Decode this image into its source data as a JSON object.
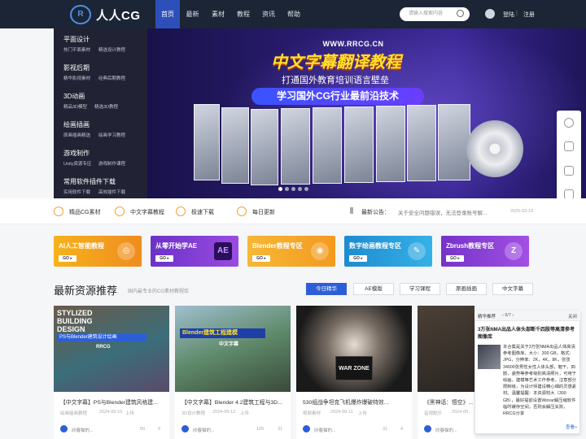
{
  "header": {
    "logo_text": "人人CG",
    "nav": [
      "首页",
      "最新",
      "素材",
      "教程",
      "资讯",
      "帮助"
    ],
    "search_placeholder": "请输入搜索内容",
    "login": "登陆",
    "divider": "|",
    "register": "注册"
  },
  "sidebar": [
    {
      "title": "平面设计",
      "subs": [
        "热门平面素材",
        "精选设计教程"
      ]
    },
    {
      "title": "影视后期",
      "subs": [
        "精华影视素材",
        "经典后期教程"
      ]
    },
    {
      "title": "3D动画",
      "subs": [
        "精品3D模型",
        "精选3D教程"
      ]
    },
    {
      "title": "绘画插画",
      "subs": [
        "原画插画精选",
        "绘画学习教程"
      ]
    },
    {
      "title": "游戏制作",
      "subs": [
        "Unity资源专区",
        "游戏制作课程"
      ]
    },
    {
      "title": "常用软件插件下载",
      "subs": [
        "实用软件下载",
        "高效插件下载"
      ]
    }
  ],
  "banner": {
    "site": "WWW.RRCG.CN",
    "title": "中文字幕翻译教程",
    "subtitle": "打通国外教育培训语言壁垒",
    "pill": "学习国外CG行业最前沿技术"
  },
  "quick_links": [
    "精品CG素材",
    "中文字幕教程",
    "极速下载",
    "每日更新"
  ],
  "notice": {
    "label": "最新公告：",
    "text": "关于安全问题错误，无法登录账号解...",
    "date": "2025-03-19"
  },
  "promo_cards": [
    {
      "title": "AI人工智能教程",
      "go": "GO ▸",
      "art": "◎",
      "color": "#f2a51d"
    },
    {
      "title": "从零开始学AE",
      "go": "GO ▸",
      "art": "AE",
      "color": "#8a3fd6"
    },
    {
      "title": "Blender教程专区",
      "go": "GO ▸",
      "art": "◉",
      "color": "#f5a623"
    },
    {
      "title": "数字绘画教程专区",
      "go": "GO ▸",
      "art": "✎",
      "color": "#2aa0d8"
    },
    {
      "title": "Zbrush教程专区",
      "go": "GO ▸",
      "art": "Z",
      "color": "#8b40d8"
    }
  ],
  "section": {
    "title": "最新资源推荐",
    "subtitle": "国内最专业的CG素材教程库",
    "tabs": [
      "今日精华",
      "AE模版",
      "学习课程",
      "原画插画",
      "中文字幕"
    ],
    "active_tab": 0
  },
  "resources": [
    {
      "title": "【中文字幕】PS与Blender建筑风格建...",
      "category": "绘画插画教程",
      "date": "2024-09-10",
      "action": "上传",
      "author": "欣春猫的...",
      "views": "50",
      "comments": "6"
    },
    {
      "title": "【中文字幕】Blender 4.2建筑工程与3D...",
      "category": "3D设计教程",
      "date": "2024-09-12",
      "action": "上传",
      "author": "欣春猫的...",
      "views": "105",
      "comments": "31"
    },
    {
      "title": "530组战争坦克飞机爆炸爆破特效...",
      "category": "视频素材",
      "date": "2024-09-11",
      "action": "上传",
      "author": "欣春猫的...",
      "views": "31",
      "comments": "4"
    },
    {
      "title": "《黑神话：悟空》...",
      "category": "音视配乐",
      "date": "2024-09",
      "action": "",
      "author": "欣春猫的...",
      "views": "",
      "comments": ""
    }
  ],
  "thumbs": {
    "t1": {
      "line1": "STYLIZED",
      "line2": "BUILDING",
      "line3": "DESIGN",
      "bar": "PS与Blender建筑设计绘画",
      "brand": "RRCG"
    },
    "t2": {
      "bar": "Blender建筑工程建模",
      "tag": "中文字幕"
    },
    "t3": {
      "big": "WAR ZONE"
    }
  },
  "popup": {
    "label": "精华推荐",
    "page": "‹ 5/7 ›",
    "close": "关闭",
    "title": "3万张NMA出品人体头部断千四肢等高清参考图像库",
    "body": "本合集是关于3万张NMA出品人体高清参考图像库，大小：300 GB，格式：JPG，分辨率：2K，4K，8K，张张34000张男性女性人体头部，躯干，四肢，姿势等参考级别高清照片，可用于绘画，建模等艺术工作参考，注意部分限制级，为设计师建设精心细的灵感素材。温馨提醒：本资源较大（300 GB），最好提前设置Winrar解压缩软件临时缓存空间，否则会解压失败，RRCG分享",
    "more": "查看»"
  },
  "colors": {
    "header_bg": "#1c2535",
    "accent": "#2c5fd7",
    "nav_active": "#2c4fb9"
  }
}
